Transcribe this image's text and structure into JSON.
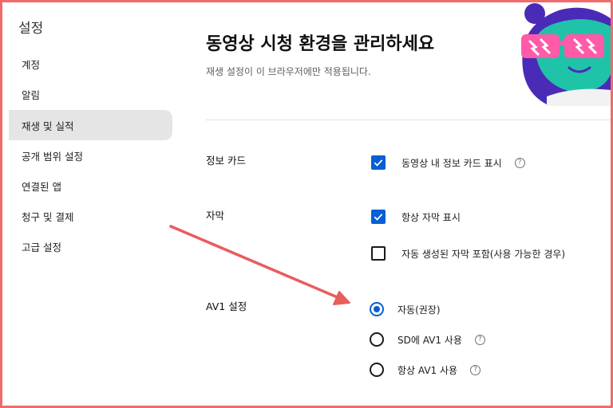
{
  "sidebar": {
    "title": "설정",
    "items": [
      {
        "label": "계정",
        "active": false
      },
      {
        "label": "알림",
        "active": false
      },
      {
        "label": "재생 및 실적",
        "active": true
      },
      {
        "label": "공개 범위 설정",
        "active": false
      },
      {
        "label": "연결된 앱",
        "active": false
      },
      {
        "label": "청구 및 결제",
        "active": false
      },
      {
        "label": "고급 설정",
        "active": false
      }
    ]
  },
  "main": {
    "title": "동영상 시청 환경을 관리하세요",
    "subtitle": "재생 설정이 이 브라우저에만 적용됩니다.",
    "sections": {
      "info_cards": {
        "label": "정보 카드",
        "options": [
          {
            "label": "동영상 내 정보 카드 표시",
            "checked": true,
            "help": "?"
          }
        ]
      },
      "captions": {
        "label": "자막",
        "options": [
          {
            "label": "항상 자막 표시",
            "checked": true
          },
          {
            "label": "자동 생성된 자막 포함(사용 가능한 경우)",
            "checked": false
          }
        ]
      },
      "av1": {
        "label": "AV1 설정",
        "options": [
          {
            "label": "자동(권장)",
            "selected": true
          },
          {
            "label": "SD에 AV1 사용",
            "selected": false,
            "help": "?"
          },
          {
            "label": "항상 AV1 사용",
            "selected": false,
            "help": "?"
          }
        ]
      }
    }
  },
  "colors": {
    "accent": "#065fd4",
    "annotation_arrow": "#e85d5d",
    "frame": "#f06b6b",
    "active_nav_bg": "#e5e5e5"
  }
}
